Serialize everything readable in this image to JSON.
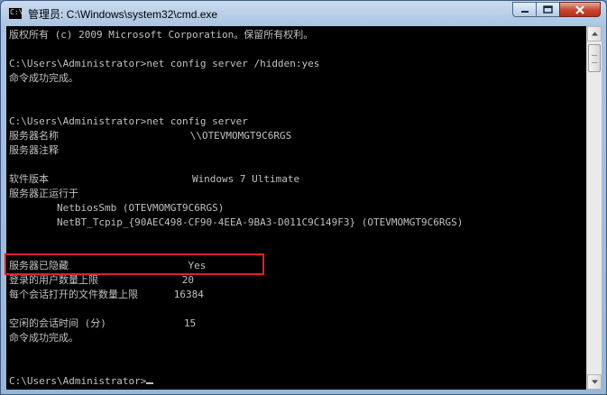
{
  "window": {
    "title": "管理员: C:\\Windows\\system32\\cmd.exe",
    "icon_text": "C:\\."
  },
  "icons": {
    "app": "command-prompt-icon",
    "minimize": "minimize-icon",
    "maximize": "maximize-icon",
    "close": "close-icon",
    "scroll_up": "arrow-up-icon",
    "scroll_down": "arrow-down-icon"
  },
  "colors": {
    "console_bg": "#000000",
    "console_text": "#c0c0c0",
    "highlight_border": "#e02020",
    "close_button": "#c9452f"
  },
  "console": {
    "lines": [
      "版权所有 (c) 2009 Microsoft Corporation。保留所有权利。",
      "",
      "C:\\Users\\Administrator>net config server /hidden:yes",
      "命令成功完成。",
      "",
      "",
      "C:\\Users\\Administrator>net config server",
      "服务器名称                      \\\\OTEVMOMGT9C6RGS",
      "服务器注释",
      "",
      "软件版本                        Windows 7 Ultimate",
      "服务器正运行于",
      "        NetbiosSmb (OTEVMOMGT9C6RGS)",
      "        NetBT_Tcpip_{90AEC498-CF90-4EEA-9BA3-D011C9C149F3} (OTEVMOMGT9C6RGS)",
      "",
      "",
      "服务器已隐藏                    Yes",
      "登录的用户数量上限              20",
      "每个会话打开的文件数量上限      16384",
      "",
      "空闲的会话时间 (分)             15",
      "命令成功完成。",
      "",
      "",
      "C:\\Users\\Administrator>"
    ]
  }
}
